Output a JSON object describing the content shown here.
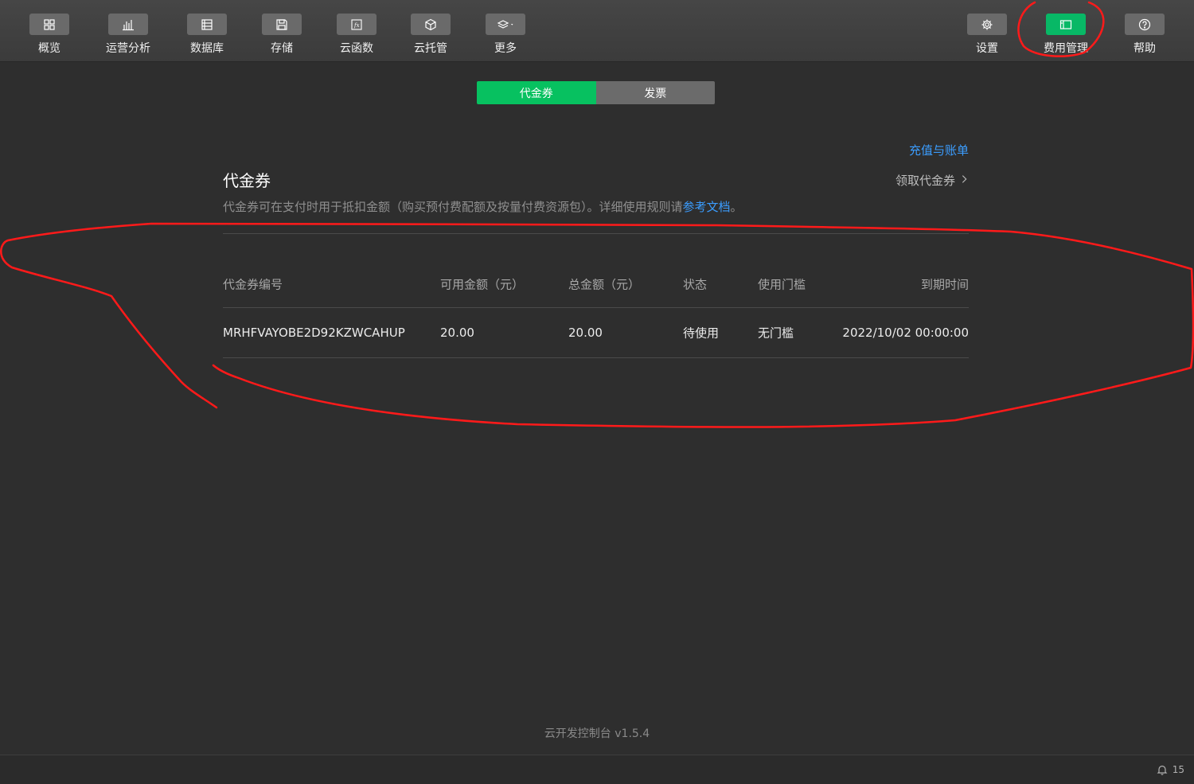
{
  "toolbar": {
    "items": [
      {
        "label": "概览",
        "icon": "grid-icon"
      },
      {
        "label": "运营分析",
        "icon": "bar-chart-icon"
      },
      {
        "label": "数据库",
        "icon": "database-icon"
      },
      {
        "label": "存储",
        "icon": "save-icon"
      },
      {
        "label": "云函数",
        "icon": "function-icon"
      },
      {
        "label": "云托管",
        "icon": "cube-icon"
      },
      {
        "label": "更多",
        "icon": "layers-icon"
      }
    ],
    "right_items": [
      {
        "label": "设置",
        "icon": "gear-icon"
      },
      {
        "label": "费用管理",
        "icon": "billing-icon",
        "active": true
      },
      {
        "label": "帮助",
        "icon": "help-icon"
      }
    ]
  },
  "tabs": [
    {
      "label": "代金券",
      "active": true
    },
    {
      "label": "发票",
      "active": false
    }
  ],
  "content": {
    "recharge_link": "充值与账单",
    "title": "代金券",
    "claim_link": "领取代金券",
    "description_prefix": "代金券可在支付时用于抵扣金额（购买预付费配额及按量付费资源包）。详细使用规则请",
    "description_link": "参考文档",
    "description_suffix": "。"
  },
  "table": {
    "headers": [
      "代金券编号",
      "可用金额（元）",
      "总金额（元）",
      "状态",
      "使用门槛",
      "到期时间"
    ],
    "rows": [
      [
        "MRHFVAYOBE2D92KZWCAHUP",
        "20.00",
        "20.00",
        "待使用",
        "无门槛",
        "2022/10/02 00:00:00"
      ]
    ]
  },
  "footer": {
    "version": "云开发控制台 v1.5.4",
    "notification_count": "15"
  },
  "colors": {
    "accent": "#07c160",
    "link": "#3b9dff",
    "annotation": "#ff1a1a"
  }
}
